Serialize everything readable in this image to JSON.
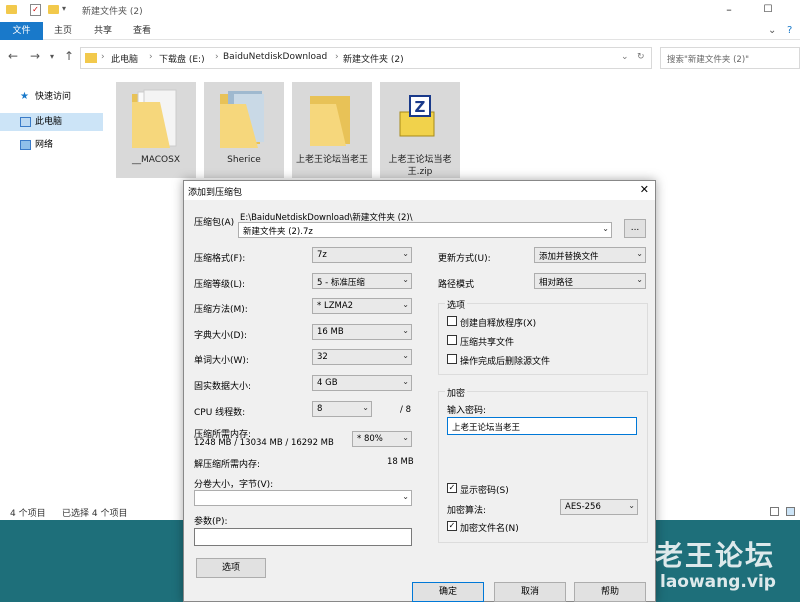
{
  "explorer": {
    "title": "新建文件夹 (2)",
    "ribbon_tabs": [
      "文件",
      "主页",
      "共享",
      "查看"
    ],
    "breadcrumbs": [
      "此电脑",
      "下载盘 (E:)",
      "BaiduNetdiskDownload",
      "新建文件夹 (2)"
    ],
    "search_placeholder": "搜索\"新建文件夹 (2)\"",
    "sidebar": [
      {
        "label": "快速访问",
        "icon": "star-icon"
      },
      {
        "label": "此电脑",
        "icon": "computer-icon",
        "active": true
      },
      {
        "label": "网络",
        "icon": "network-icon"
      }
    ],
    "files": [
      {
        "name": "__MACOSX",
        "type": "folder"
      },
      {
        "name": "Sherice",
        "type": "folder"
      },
      {
        "name": "上老王论坛当老王",
        "type": "folder"
      },
      {
        "name": "上老王论坛当老王.zip",
        "type": "zip"
      }
    ],
    "status": {
      "count": "4 个项目",
      "selected": "已选择 4 个项目"
    }
  },
  "dialog": {
    "title": "添加到压缩包",
    "archive_label": "压缩包(A)",
    "archive_path": "E:\\BaiduNetdiskDownload\\新建文件夹 (2)\\",
    "archive_name": "新建文件夹 (2).7z",
    "browse_label": "...",
    "format_label": "压缩格式(F):",
    "format_value": "7z",
    "level_label": "压缩等级(L):",
    "level_value": "5 - 标准压缩",
    "method_label": "压缩方法(M):",
    "method_value": "* LZMA2",
    "dict_label": "字典大小(D):",
    "dict_value": "16 MB",
    "word_label": "单词大小(W):",
    "word_value": "32",
    "solid_label": "固实数据大小:",
    "solid_value": "4 GB",
    "threads_label": "CPU 线程数:",
    "threads_value": "8",
    "threads_total": "/ 8",
    "mem_label": "压缩所需内存:",
    "mem_detail": "1248 MB / 13034 MB / 16292 MB",
    "mem_value": "* 80%",
    "decomp_label": "解压缩所需内存:",
    "decomp_value": "18 MB",
    "split_label": "分卷大小，字节(V):",
    "params_label": "参数(P):",
    "options_btn": "选项",
    "update_label": "更新方式(U):",
    "update_value": "添加并替换文件",
    "path_label": "路径模式",
    "path_value": "相对路径",
    "options_group": "选项",
    "opt_sfx": "创建自释放程序(X)",
    "opt_shared": "压缩共享文件",
    "opt_delete": "操作完成后删除源文件",
    "encrypt_group": "加密",
    "pwd_label": "输入密码:",
    "pwd_value": "上老王论坛当老王",
    "show_pwd": "显示密码(S)",
    "enc_method_label": "加密算法:",
    "enc_method_value": "AES-256",
    "enc_names": "加密文件名(N)",
    "ok": "确定",
    "cancel": "取消",
    "help": "帮助"
  },
  "watermark": {
    "line1": "老王论坛",
    "line2": "laowang.vip"
  }
}
